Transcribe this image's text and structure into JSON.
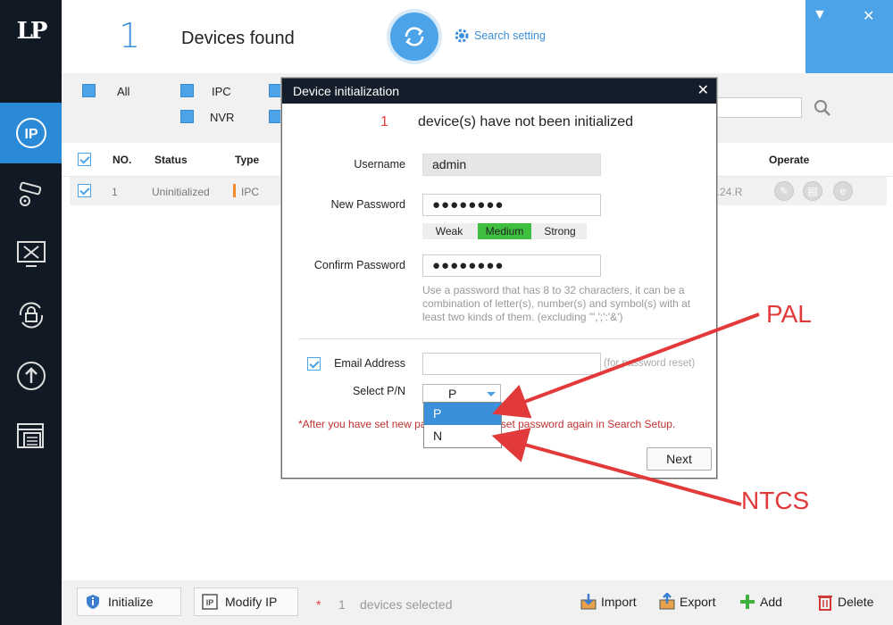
{
  "app": {
    "logo_text": "LP"
  },
  "header": {
    "found_count": "1",
    "found_label": "Devices found",
    "search_setting_label": "Search setting",
    "min_glyph": "▼",
    "close_glyph": "✕"
  },
  "filters": {
    "all": "All",
    "ipc": "IPC",
    "nvr": "NVR"
  },
  "table": {
    "columns": {
      "no": "NO.",
      "status": "Status",
      "type": "Type",
      "operate": "Operate"
    },
    "rows": [
      {
        "no": "1",
        "status": "Uninitialized",
        "type": "IPC",
        "version_tail": "0.24.R"
      }
    ]
  },
  "bottom": {
    "initialize_label": "Initialize",
    "modify_ip_label": "Modify IP",
    "selected_star": "*",
    "selected_count": "1",
    "selected_text": "devices selected",
    "import_label": "Import",
    "export_label": "Export",
    "add_label": "Add",
    "delete_label": "Delete"
  },
  "modal": {
    "title": "Device initialization",
    "close_glyph": "✕",
    "uninit_count": "1",
    "uninit_text": "device(s) have not been initialized",
    "username_label": "Username",
    "username_value": "admin",
    "new_password_label": "New Password",
    "new_password_value": "●●●●●●●●",
    "strength_weak": "Weak",
    "strength_medium": "Medium",
    "strength_strong": "Strong",
    "confirm_password_label": "Confirm Password",
    "confirm_password_value": "●●●●●●●●",
    "password_hint": "Use a password that has 8 to 32 characters, it can be a combination of letter(s), number(s) and symbol(s) with at least two kinds of them. (excluding '\",';':'&')",
    "email_label": "Email Address",
    "email_value": "",
    "email_note": "(for password reset)",
    "select_pn_label": "Select P/N",
    "select_pn_value": "P",
    "pn_options": [
      "P",
      "N"
    ],
    "after_set_warning": "*After you have set new password, please set password again in Search Setup.",
    "next_label": "Next"
  },
  "annotations": {
    "pal": "PAL",
    "ntcs": "NTCS"
  },
  "colors": {
    "accent": "#4da3e8",
    "sidebar_bg": "#111a24",
    "strength_medium": "#3fbf3f",
    "annotation_red": "#e23a3a"
  }
}
